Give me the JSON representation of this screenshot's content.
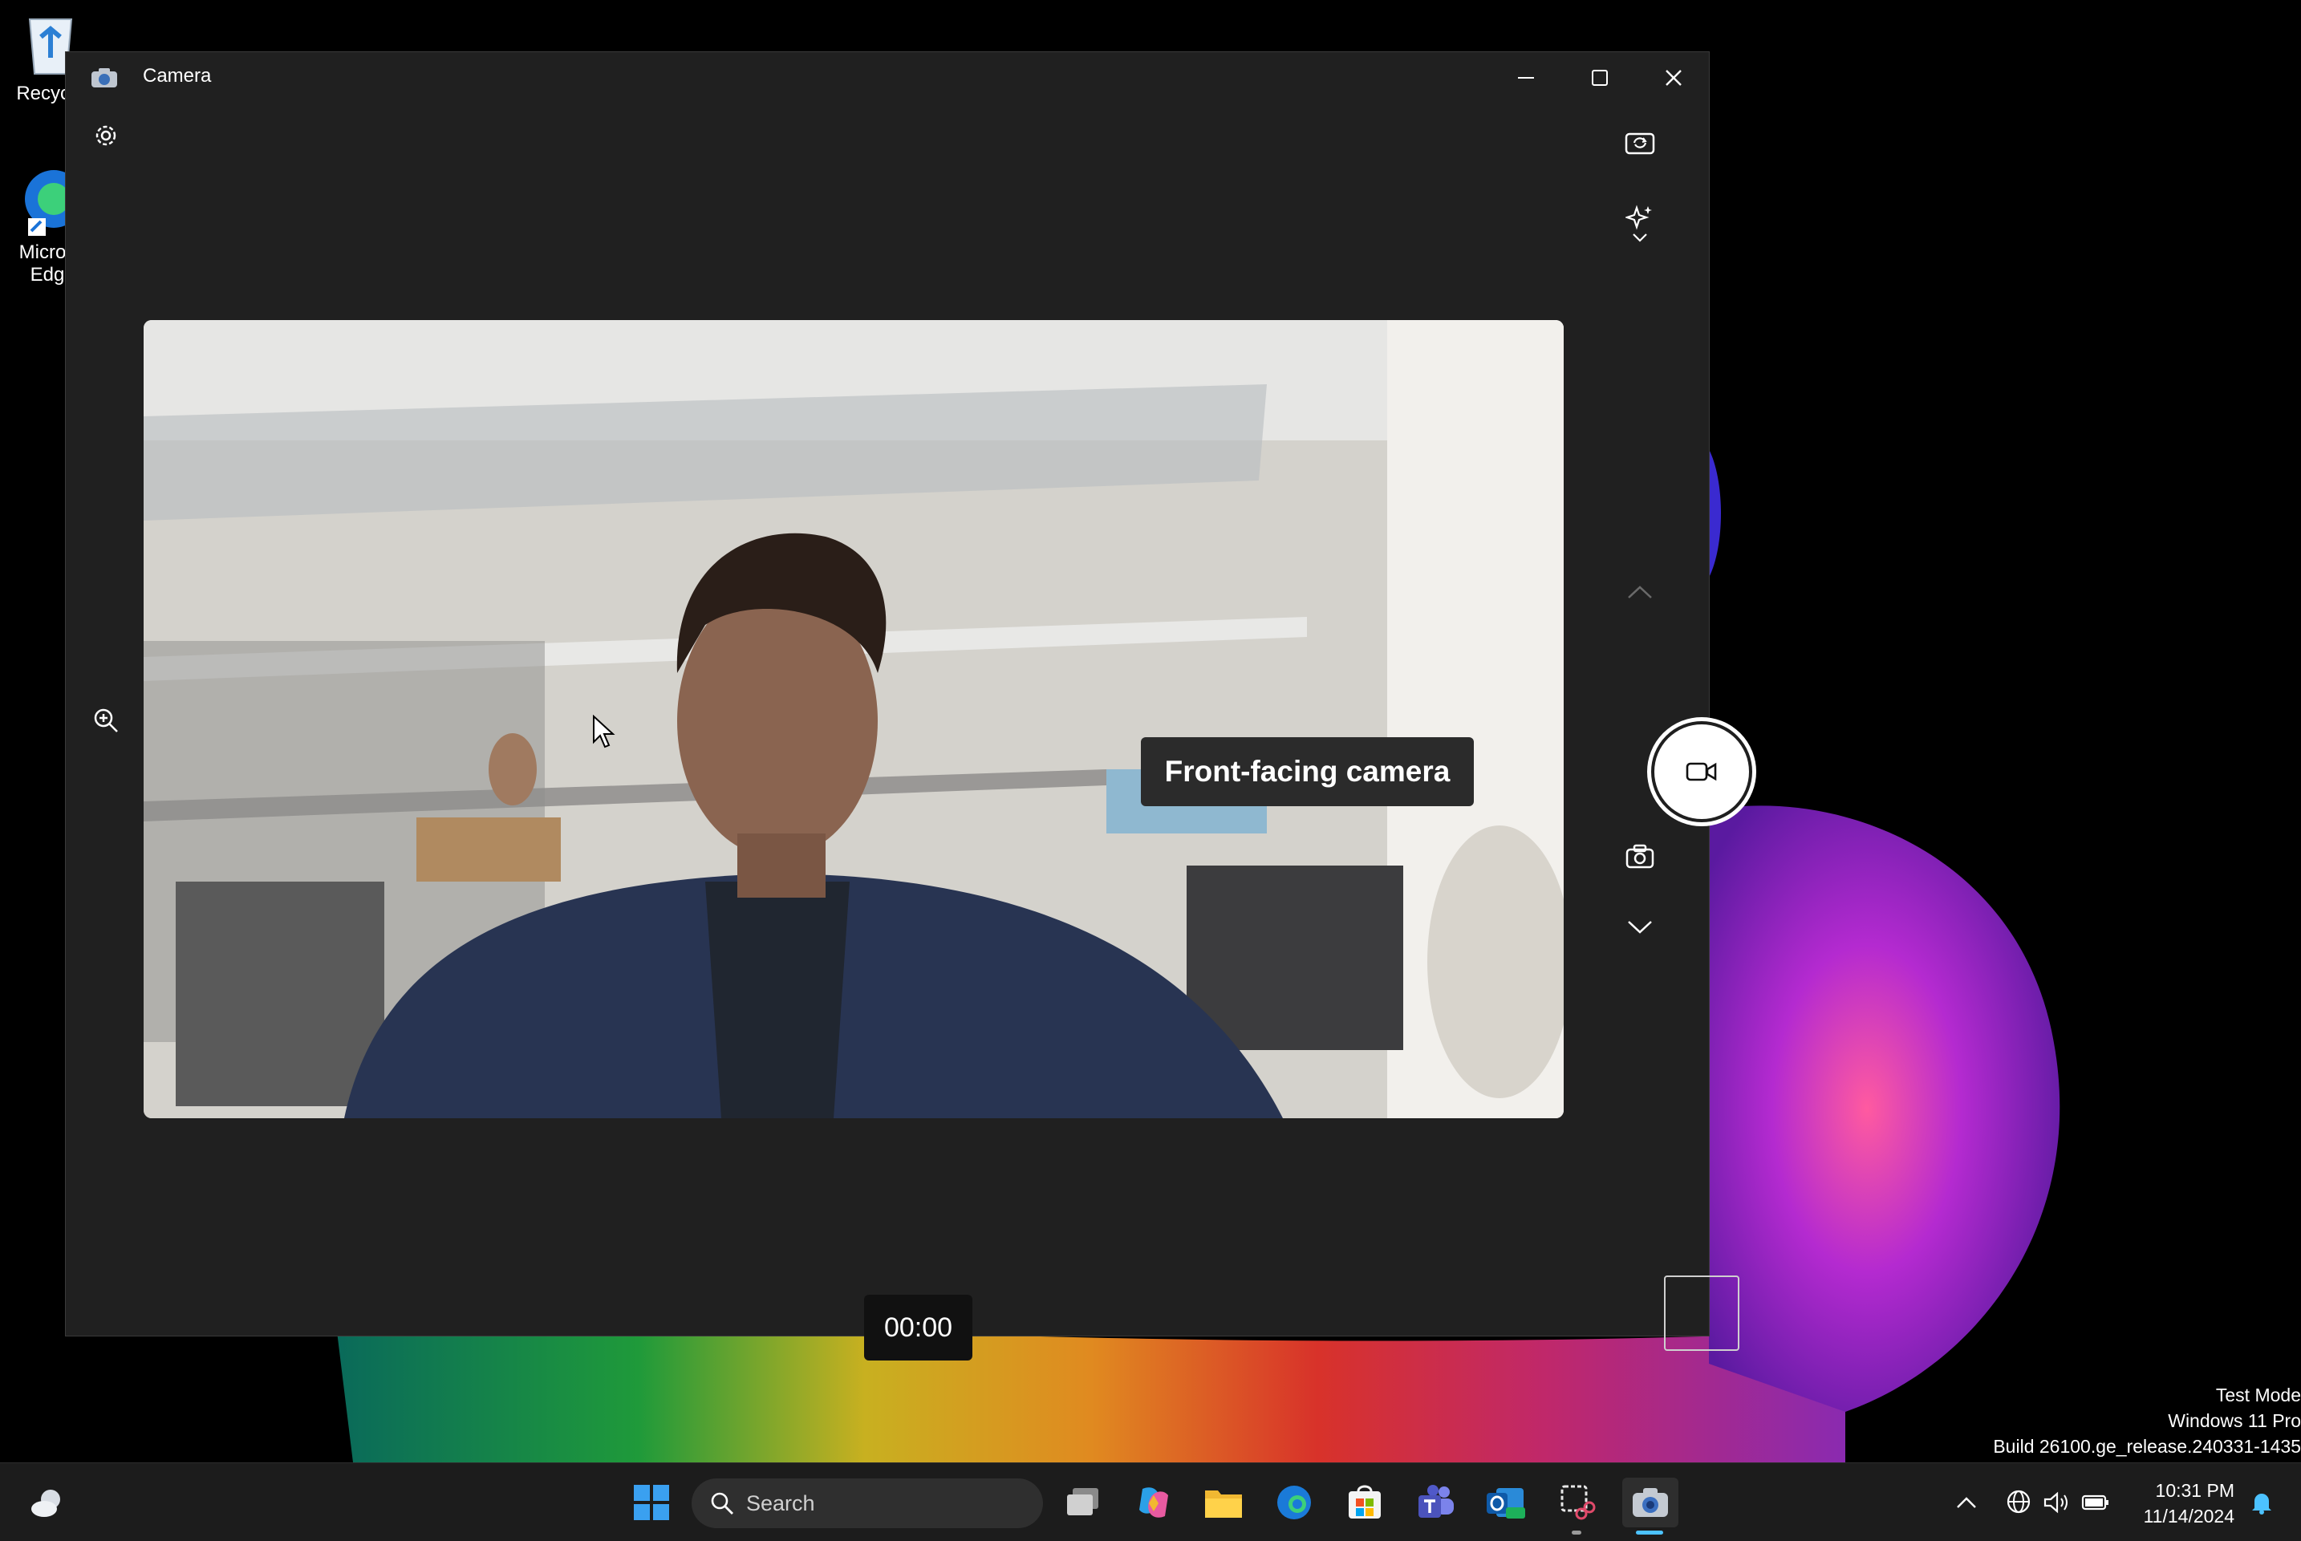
{
  "desktop": {
    "icons": [
      {
        "label": "Recycle",
        "icon": "recycle-bin-icon"
      },
      {
        "label": "Micros\nEdg",
        "icon": "edge-icon"
      }
    ],
    "watermark": {
      "line1": "Test Mode",
      "line2": "Windows 11 Pro",
      "line3": "Build 26100.ge_release.240331-1435"
    }
  },
  "window": {
    "title": "Camera",
    "app_icon": "camera-app-icon",
    "controls": [
      "minimize-icon",
      "maximize-icon",
      "close-icon"
    ],
    "left_tools": [
      "settings-gear-icon",
      "zoom-in-icon"
    ],
    "right_tools": [
      "switch-camera-icon",
      "effects-sparkle-icon",
      "chevron-up-icon",
      "video-mode-icon",
      "photo-mode-icon",
      "chevron-down-icon"
    ],
    "tooltip": "Front-facing camera",
    "timer": "00:00"
  },
  "taskbar": {
    "search_placeholder": "Search",
    "apps": [
      "widgets-weather-icon",
      "start-icon",
      "task-view-icon",
      "copilot-icon",
      "file-explorer-icon",
      "edge-icon",
      "store-icon",
      "teams-icon",
      "outlook-new-icon",
      "snipping-tool-icon",
      "camera-icon"
    ],
    "tray": [
      "show-hidden-icons-icon",
      "network-globe-icon",
      "volume-icon",
      "battery-icon",
      "notification-bell-icon"
    ],
    "time": "10:31 PM",
    "date": "11/14/2024"
  },
  "colors": {
    "window_bg": "#202020",
    "taskbar_bg": "#1c1c1c",
    "accent": "#4cc2ff"
  }
}
